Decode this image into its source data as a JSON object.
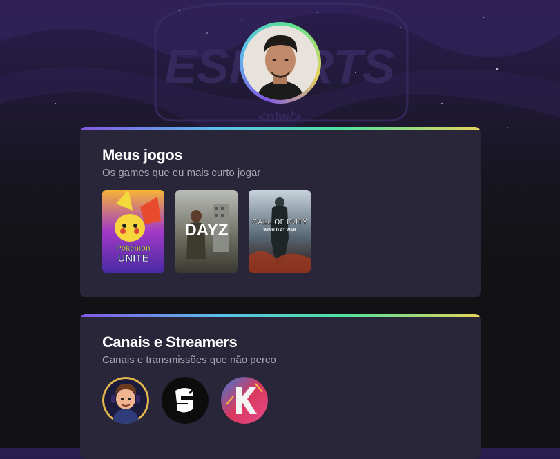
{
  "background": {
    "watermark_text": "ESPORTS",
    "watermark_sub": "<nlw/>"
  },
  "profile": {
    "avatar_icon": "profile-photo"
  },
  "games_section": {
    "title": "Meus jogos",
    "subtitle": "Os games que eu mais curto jogar",
    "games": [
      {
        "label": "Pokémon UNITE",
        "logo_top": "Pokémon",
        "logo_bottom": "UNITE"
      },
      {
        "label": "DayZ",
        "logo": "DAYZ"
      },
      {
        "label": "Call of Duty World at War",
        "logo_top": "CALL OF DUTY",
        "logo_bottom": "WORLD AT WAR"
      }
    ]
  },
  "channels_section": {
    "title": "Canais e Streamers",
    "subtitle": "Canais e transmissões que não perco",
    "channels": [
      {
        "icon": "streamer-cartoon-avatar"
      },
      {
        "icon": "rainbow-six-logo"
      },
      {
        "icon": "k-logo"
      }
    ]
  },
  "colors": {
    "accent_purple": "#8257e5",
    "accent_green": "#4fe3a0",
    "accent_yellow": "#e6d35b",
    "card_bg": "#29263a",
    "subtitle_text": "#a8a8b3"
  }
}
